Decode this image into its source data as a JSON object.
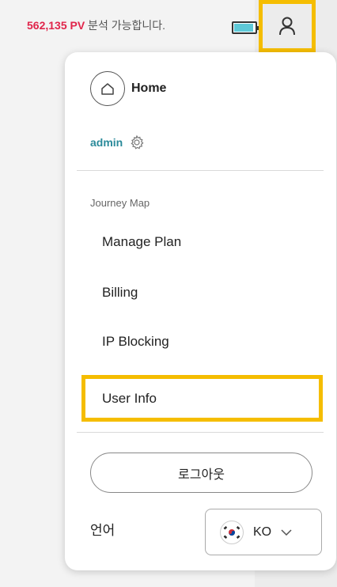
{
  "topbar": {
    "pv_count": "562,135 PV",
    "pv_suffix": " 분석 가능합니다.",
    "icons": [
      "battery-icon",
      "user-icon"
    ]
  },
  "menu": {
    "home_label": "Home",
    "user_name": "admin",
    "section_label": "Journey Map",
    "items": [
      {
        "label": "Manage Plan"
      },
      {
        "label": "Billing"
      },
      {
        "label": "IP Blocking"
      },
      {
        "label": "User Info"
      }
    ],
    "logout_label": "로그아웃",
    "language_label": "언어",
    "language_code": "KO"
  },
  "colors": {
    "accent_highlight": "#f5bd00",
    "pv_number": "#e0244a",
    "admin_name": "#2a8a9a",
    "battery_fill": "#5ec9d8"
  }
}
